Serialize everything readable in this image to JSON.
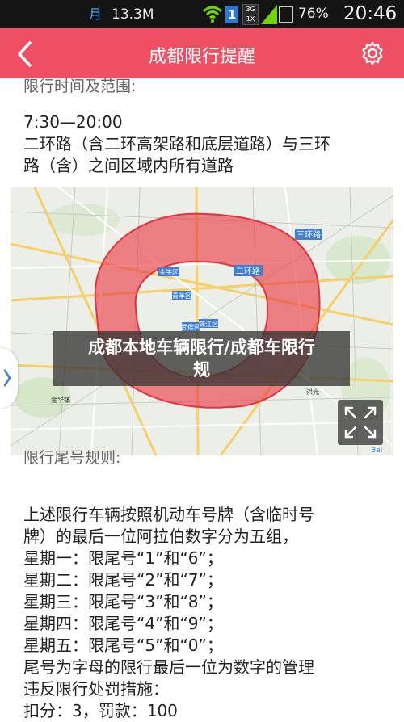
{
  "status_bar": {
    "moon_glyph": "月",
    "speed": "13.3M",
    "sim_badge": "1",
    "network": "3G\n1X",
    "battery": "76%",
    "time": "20:46"
  },
  "header": {
    "title": "成都限行提醒",
    "bg_color": "#ef4f62"
  },
  "section1": {
    "heading": "限行时间及范围:",
    "time_range": "7:30—20:00",
    "area_line1": "二环路（含二环高架路和底层道路）与三环",
    "area_line2": "路（含）之间区域内所有道路"
  },
  "map": {
    "labels": {
      "third_ring": "三环路",
      "second_ring": "二环路",
      "jinniu": "金牛区",
      "qingyang": "青羊区",
      "wuhou": "武侯区",
      "jinjiang": "锦江区",
      "hongguang": "洪光",
      "jinhua": "金华镇",
      "baidu": "Bai"
    },
    "caption_line1": "成都本地车辆限行/成都车限行",
    "caption_line2": "规"
  },
  "section2": {
    "heading": "限行尾号规则:",
    "lines": [
      "上述限行车辆按照机动车号牌（含临时号",
      "牌）的最后一位阿拉伯数字分为五组，",
      "星期一：限尾号“1”和“6”；",
      "星期二：限尾号“2”和“7”；",
      "星期三：限尾号“3”和“8”；",
      "星期四：限尾号“4”和“9”；",
      "星期五：限尾号“5”和“0”；",
      "尾号为字母的限行最后一位为数字的管理",
      "违反限行处罚措施：",
      "扣分：3，罚款：100"
    ]
  }
}
